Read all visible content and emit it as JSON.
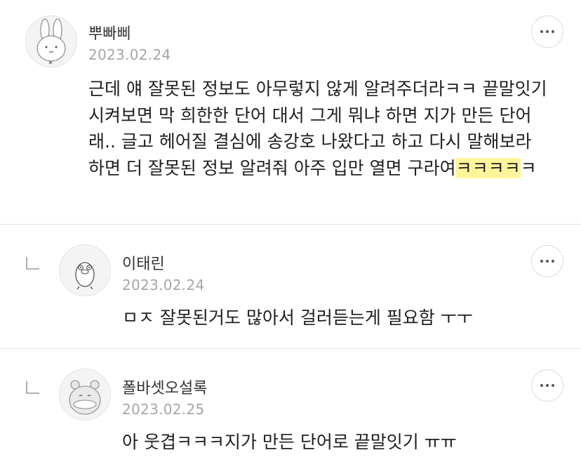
{
  "comments": [
    {
      "author": "뿌빠삐",
      "date": "2023.02.24",
      "body_parts": [
        "근데 얘 잘못된 정보도 아무렇지 않게 알려주더라ㅋㅋ 끝말잇기 시켜보면 막 희한한 단어 대서 그게 뭐냐 하면 지가 만든 단어래.. 글고 헤어질 결심에 송강호 나왔다고 하고 다시 말해보라 하면 더 잘못된 정보 알려줘 아주 입만 열면 구라여",
        "ㅋㅋㅋㅋ",
        "ㅋ"
      ],
      "avatar_icon": "rabbit-avatar-icon",
      "more_icon": "more-options-icon"
    },
    {
      "author": "이태린",
      "date": "2023.02.24",
      "body": "ㅁㅈ 잘못된거도 많아서 걸러듣는게 필요함 ㅜㅜ",
      "avatar_icon": "bird-avatar-icon",
      "more_icon": "more-options-icon",
      "reply_icon": "reply-arrow-icon"
    },
    {
      "author": "폴바셋오설록",
      "date": "2023.02.25",
      "body": "아 웃겹ㅋㅋㅋ지가 만든 단어로 끝말잇기 ㅠㅠ",
      "avatar_icon": "bear-avatar-icon",
      "more_icon": "more-options-icon",
      "reply_icon": "reply-arrow-icon"
    }
  ],
  "colors": {
    "highlight": "#fff59a",
    "date": "#a6a6a6",
    "divider": "#e3e3e3"
  }
}
